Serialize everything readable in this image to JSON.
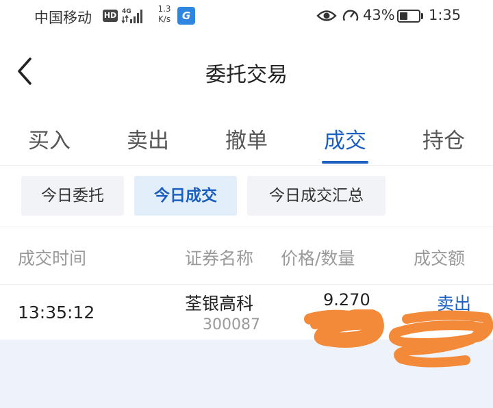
{
  "status_bar": {
    "carrier": "中国移动",
    "hd": "HD",
    "network": "4G",
    "speed_value": "1.3",
    "speed_unit": "K/s",
    "battery_percent": "43%",
    "battery_level": 0.43,
    "time": "1:35",
    "icons": [
      "hd-badge-icon",
      "signal-icon",
      "app-notification-icon",
      "eye-icon",
      "gauge-icon",
      "battery-icon"
    ]
  },
  "nav": {
    "title": "委托交易",
    "back_icon": "chevron-left-icon"
  },
  "tabs": [
    {
      "label": "买入",
      "active": false
    },
    {
      "label": "卖出",
      "active": false
    },
    {
      "label": "撤单",
      "active": false
    },
    {
      "label": "成交",
      "active": true
    },
    {
      "label": "持仓",
      "active": false
    }
  ],
  "sub_tabs": [
    {
      "label": "今日委托",
      "active": false
    },
    {
      "label": "今日成交",
      "active": true
    },
    {
      "label": "今日成交汇总",
      "active": false
    }
  ],
  "table": {
    "headers": [
      "成交时间",
      "证券名称",
      "价格/数量",
      "成交额"
    ],
    "rows": [
      {
        "time": "13:35:12",
        "name": "荃银高科",
        "code": "300087",
        "price": "9.270",
        "side": "卖出"
      }
    ]
  },
  "colors": {
    "accent": "#1b5fc0",
    "redaction": "#f28a3a",
    "muted_text": "#9a9a9a",
    "footer_bg": "#eef3fb"
  }
}
